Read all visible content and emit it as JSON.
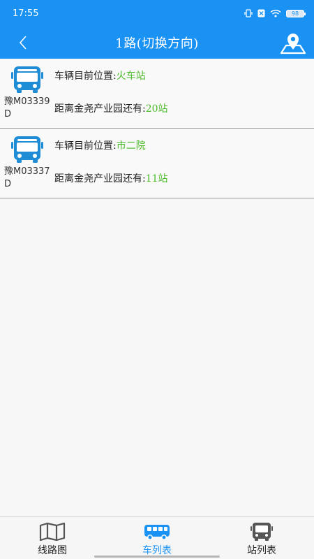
{
  "status_bar": {
    "time": "17:55",
    "battery": "98",
    "icons": [
      "vibrate-icon",
      "no-sim-icon",
      "wifi-icon",
      "battery-icon"
    ]
  },
  "nav": {
    "title": "1路(切换方向)",
    "back_icon": "chevron-left-icon",
    "map_icon": "map-pin-icon"
  },
  "buses": [
    {
      "plate": "豫M03339D",
      "position_label": "车辆目前位置:",
      "position_value": "火车站",
      "distance_label": "距离金尧产业园还有:",
      "distance_value": "20站"
    },
    {
      "plate": "豫M03337D",
      "position_label": "车辆目前位置:",
      "position_value": "市二院",
      "distance_label": "距离金尧产业园还有:",
      "distance_value": "11站"
    }
  ],
  "tabs": [
    {
      "label": "线路图",
      "icon": "map-icon",
      "active": false
    },
    {
      "label": "车列表",
      "icon": "bus-side-icon",
      "active": true
    },
    {
      "label": "站列表",
      "icon": "bus-front-icon",
      "active": false
    }
  ],
  "colors": {
    "primary": "#1a92f3",
    "highlight": "#4cba2a",
    "bus_icon": "#1f8dd6"
  }
}
